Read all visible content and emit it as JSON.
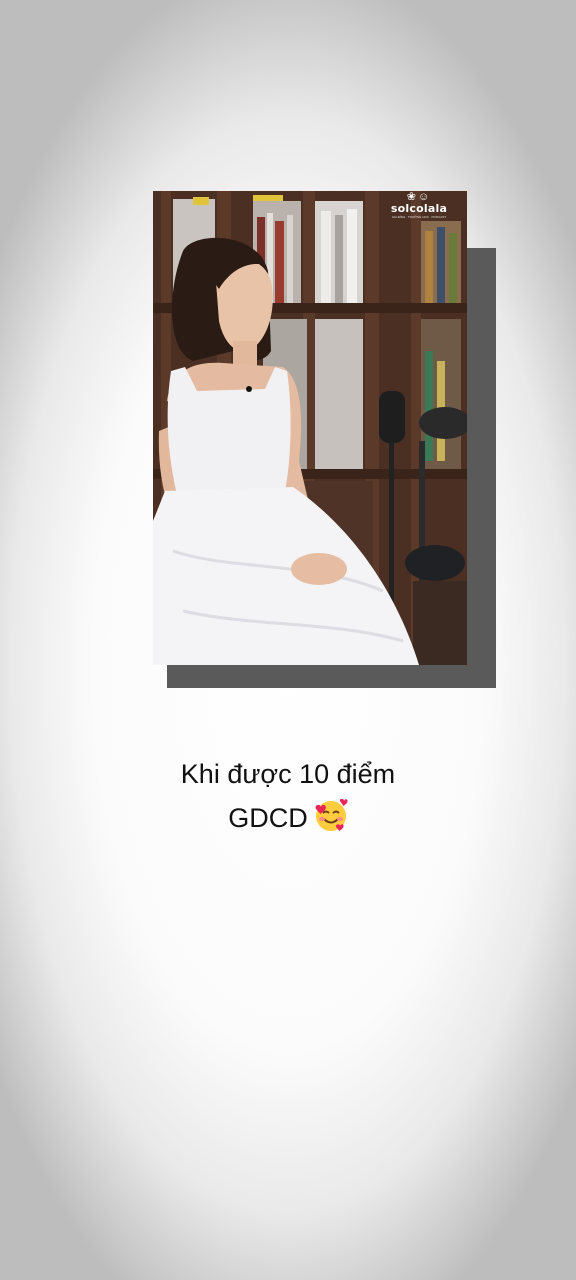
{
  "photo": {
    "logo": {
      "brand": "solcolala",
      "tagline": "GIA ĐÌNH · TRƯỜNG HỌC · PODCAST"
    }
  },
  "caption": {
    "line1": "Khi được 10 điểm",
    "line2": "GDCD",
    "emoji": "smiling-face-with-hearts"
  },
  "colors": {
    "background": "#ffffff",
    "shadow_block": "#5a5a5a",
    "caption_text": "#111111",
    "dress": "#f1f1f3",
    "bookcase_wood": "#4a2f22"
  }
}
